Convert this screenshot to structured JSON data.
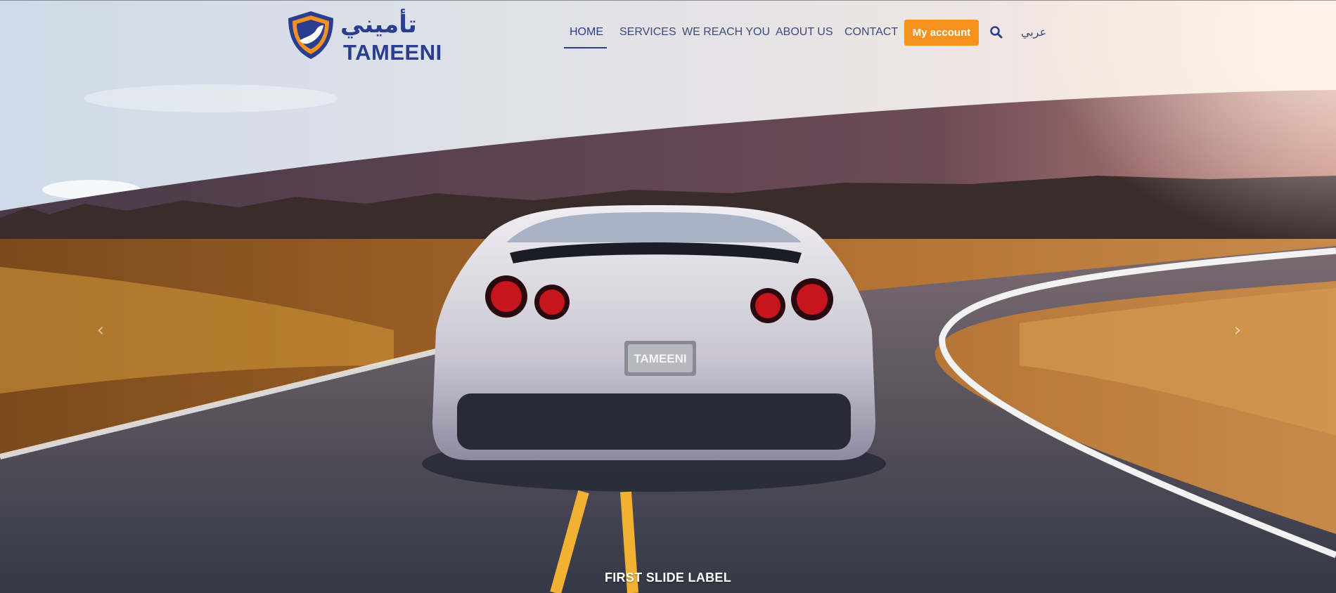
{
  "brand": {
    "name_ar": "تأميني",
    "name_en": "TAMEENI"
  },
  "nav": {
    "items": [
      {
        "label": "HOME",
        "active": true
      },
      {
        "label": "SERVICES",
        "active": false
      },
      {
        "label": "WE REACH YOU",
        "active": false
      },
      {
        "label": "ABOUT US",
        "active": false
      },
      {
        "label": "CONTACT",
        "active": false
      }
    ],
    "account_button": "My account",
    "search_icon": "search-icon",
    "language_link": "عربي"
  },
  "hero": {
    "plate_text": "TAMEENI",
    "slide_label": "FIRST SLIDE LABEL",
    "prev_icon": "chevron-left-icon",
    "next_icon": "chevron-right-icon"
  },
  "colors": {
    "brand_blue": "#2b3d8f",
    "accent_orange": "#f5921e",
    "nav_text": "#3d4a7a"
  }
}
